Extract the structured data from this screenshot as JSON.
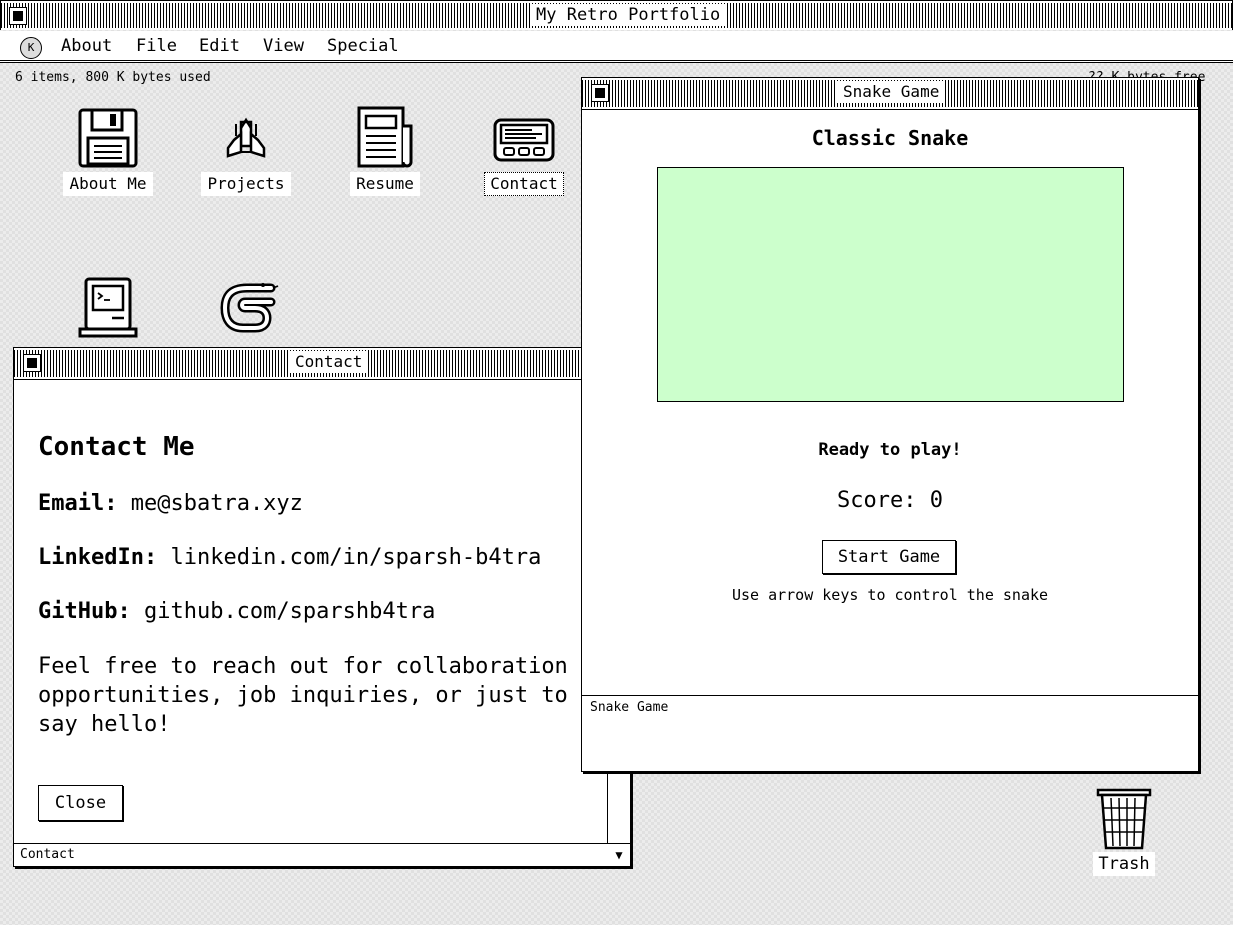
{
  "window": {
    "title": "My Retro Portfolio"
  },
  "menu": {
    "logo": "K",
    "items": [
      "About",
      "File",
      "Edit",
      "View",
      "Special"
    ]
  },
  "status": {
    "left": "6 items, 800 K bytes used",
    "right": "?? K bytes free"
  },
  "desktop_icons": [
    {
      "label": "About Me",
      "icon": "floppy-disk-icon"
    },
    {
      "label": "Projects",
      "icon": "spaceship-icon"
    },
    {
      "label": "Resume",
      "icon": "newspaper-icon"
    },
    {
      "label": "Contact",
      "icon": "pager-icon",
      "selected": true
    },
    {
      "label": "",
      "icon": "computer-terminal-icon"
    },
    {
      "label": "",
      "icon": "snake-icon"
    }
  ],
  "contact_window": {
    "title": "Contact",
    "heading": "Contact Me",
    "email_label": "Email:",
    "email": "me@sbatra.xyz",
    "linkedin_label": "LinkedIn:",
    "linkedin": "linkedin.com/in/sparsh-b4tra",
    "github_label": "GitHub:",
    "github": "github.com/sparshb4tra",
    "message": "Feel free to reach out for collaboration opportunities, job inquiries, or just to say hello!",
    "close_label": "Close",
    "footer": "Contact",
    "scroll_arrow": "▼"
  },
  "snake_window": {
    "title": "Snake Game",
    "heading": "Classic Snake",
    "status": "Ready to play!",
    "score_label": "Score: 0",
    "start_label": "Start Game",
    "hint": "Use arrow keys to control the snake",
    "footer": "Snake Game",
    "board_color": "#ccffcc"
  },
  "trash": {
    "label": "Trash"
  }
}
